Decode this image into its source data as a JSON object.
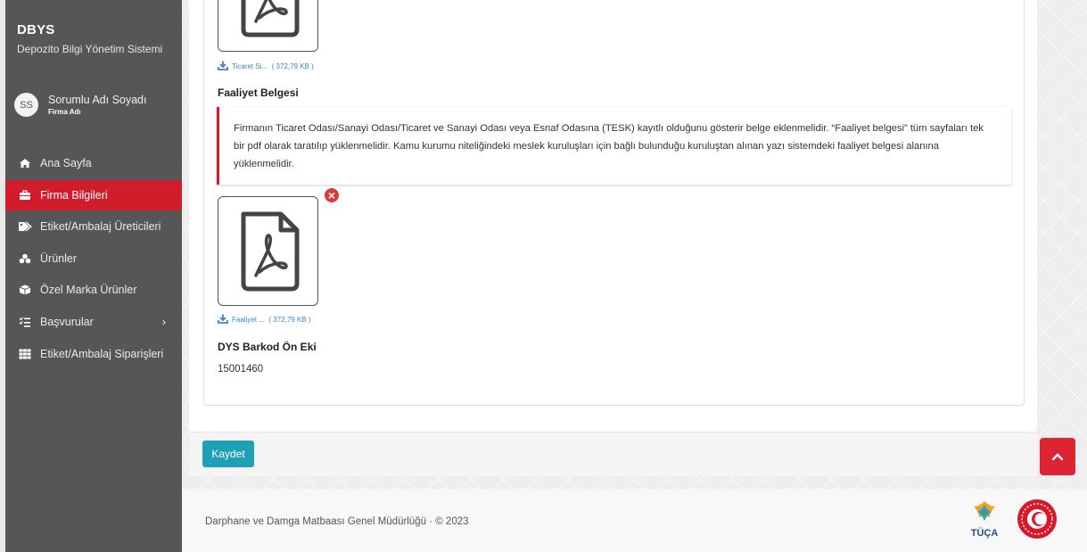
{
  "brand": {
    "title": "DBYS",
    "subtitle": "Depozito Bilgi Yönetim Sistemi"
  },
  "user": {
    "initials": "SS",
    "name": "Sorumlu Adı Soyadı",
    "company": "Firma Adı"
  },
  "menu": [
    {
      "label": "Ana Sayfa",
      "icon": "home-icon",
      "active": false
    },
    {
      "label": "Firma Bilgileri",
      "icon": "briefcase-icon",
      "active": true
    },
    {
      "label": "Etiket/Ambalaj Üreticileri",
      "icon": "tags-icon",
      "active": false
    },
    {
      "label": "Ürünler",
      "icon": "cubes-icon",
      "active": false
    },
    {
      "label": "Özel Marka Ürünler",
      "icon": "box-icon",
      "active": false
    },
    {
      "label": "Başvurular",
      "icon": "tasks-icon",
      "active": false,
      "has_submenu": true
    },
    {
      "label": "Etiket/Ambalaj Siparişleri",
      "icon": "grid-icon",
      "active": false
    }
  ],
  "files": {
    "ticaret": {
      "name": "Ticaret Si...",
      "size": "( 372,79 KB )"
    },
    "faaliyet": {
      "name": "Faaliyet ...",
      "size": "( 372,79 KB )"
    }
  },
  "faaliyet": {
    "title": "Faaliyet Belgesi",
    "info": "Firmanın Ticaret Odası/Sanayi Odası/Ticaret ve Sanayi Odası veya Esnaf Odasına (TESK) kayıtlı olduğunu gösterir belge eklenmelidir. “Faaliyet belgesi” tüm sayfaları tek bir pdf olarak taratılıp yüklenmelidir. Kamu kurumu niteliğindeki meslek kuruluşları için bağlı bulunduğu kuruluştan alınan yazı sistemdeki faaliyet belgesi alanına yüklenmelidir."
  },
  "barkod": {
    "title": "DYS Barkod Ön Eki",
    "value": "15001460"
  },
  "actions": {
    "save_label": "Kaydet"
  },
  "footer": {
    "copyright": "Darphane ve Damga Matbaası Genel Müdürlüğü · © 2023",
    "logo_text": "TÜÇA"
  },
  "colors": {
    "accent": "#d11c2b",
    "primary_button": "#1fa1b5",
    "sidebar": "#565656",
    "link": "#3a86c9"
  }
}
